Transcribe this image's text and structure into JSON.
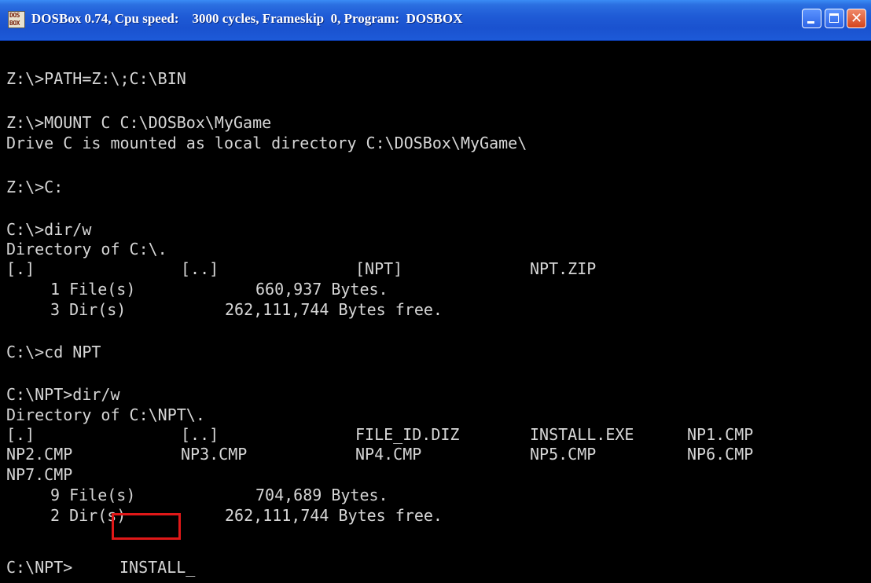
{
  "window": {
    "title": "DOSBox 0.74, Cpu speed:    3000 cycles, Frameskip  0, Program:  DOSBOX",
    "icon": "dosbox-icon",
    "icon_text": "DOS BOX",
    "buttons": [
      "minimize",
      "maximize",
      "close"
    ],
    "close_glyph": "✕"
  },
  "console": {
    "lines": {
      "l1": "Z:\\>PATH=Z:\\;C:\\BIN",
      "l2": "Z:\\>MOUNT C C:\\DOSBox\\MyGame",
      "l3": "Drive C is mounted as local directory C:\\DOSBox\\MyGame\\",
      "l4": "Z:\\>C:",
      "l5": "C:\\>dir/w",
      "l6": "Directory of C:\\.",
      "l9": "C:\\>cd NPT",
      "l10": "C:\\NPT>dir/w",
      "l11": "Directory of C:\\NPT\\.",
      "prompt": "C:\\NPT>",
      "command": "INSTALL_"
    },
    "dir1": {
      "entries": [
        "[.]",
        "[..]",
        "[NPT]",
        "NPT.ZIP"
      ],
      "files": "1 File(s)",
      "files_bytes": "660,937 Bytes.",
      "dirs": "3 Dir(s)",
      "dirs_bytes": "262,111,744 Bytes free."
    },
    "dir2": {
      "row1": [
        "[.]",
        "[..]",
        "FILE_ID.DIZ",
        "INSTALL.EXE",
        "NP1.CMP"
      ],
      "row2": [
        "NP2.CMP",
        "NP3.CMP",
        "NP4.CMP",
        "NP5.CMP",
        "NP6.CMP"
      ],
      "row3": [
        "NP7.CMP"
      ],
      "files": "9 File(s)",
      "files_bytes": "704,689 Bytes.",
      "dirs": "2 Dir(s)",
      "dirs_bytes": "262,111,744 Bytes free."
    },
    "highlight_color": "#e01818"
  }
}
